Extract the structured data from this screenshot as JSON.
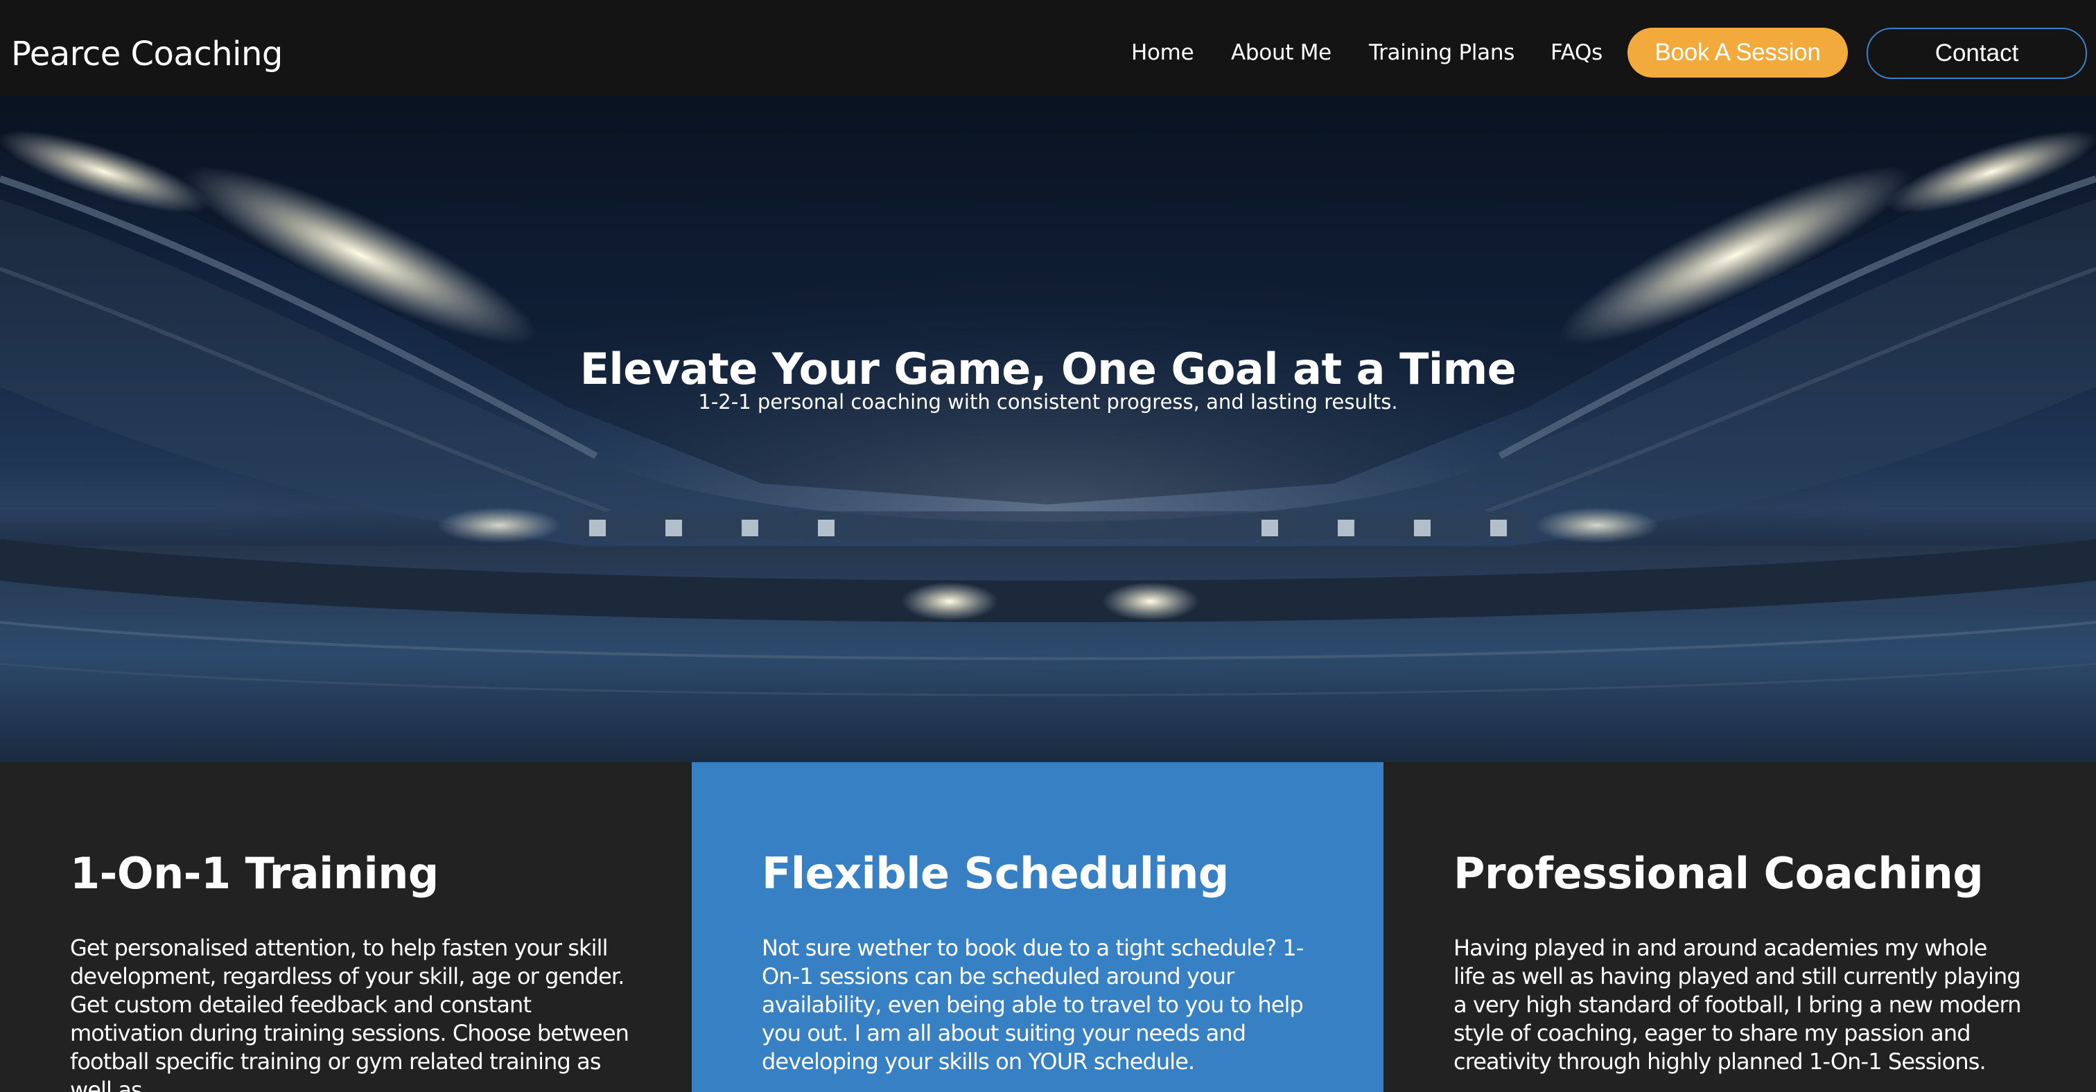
{
  "navbar": {
    "brand": "Pearce Coaching",
    "links": [
      "Home",
      "About Me",
      "Training Plans",
      "FAQs"
    ],
    "book_label": "Book A Session",
    "contact_label": "Contact"
  },
  "hero": {
    "title": "Elevate Your Game, One Goal at a Time",
    "subtitle": "1-2-1 personal coaching with consistent progress, and lasting results."
  },
  "features": [
    {
      "title": "1-On-1 Training",
      "text": "Get personalised attention, to help fasten your skill development, regardless of your skill, age or gender. Get custom detailed feedback and constant motivation during training sessions. Choose between football specific training or gym related training as well as"
    },
    {
      "title": "Flexible Scheduling",
      "text": "Not sure wether to book due to a tight schedule? 1-On-1 sessions can be scheduled around your availability, even being able to travel to you to help you out. I am all about suiting your needs and developing your skills on YOUR schedule."
    },
    {
      "title": "Professional Coaching",
      "text": "Having played in and around academies my whole life as well as having played and still currently playing a very high standard of football, I bring a new modern style of coaching, eager to share my passion and creativity through highly planned 1-On-1 Sessions."
    }
  ],
  "colors": {
    "navbar_bg": "#141414",
    "book_button": "#f2aa3d",
    "contact_border": "#3a7fcc",
    "feature_dark": "#222222",
    "feature_blue": "#3880c4"
  }
}
